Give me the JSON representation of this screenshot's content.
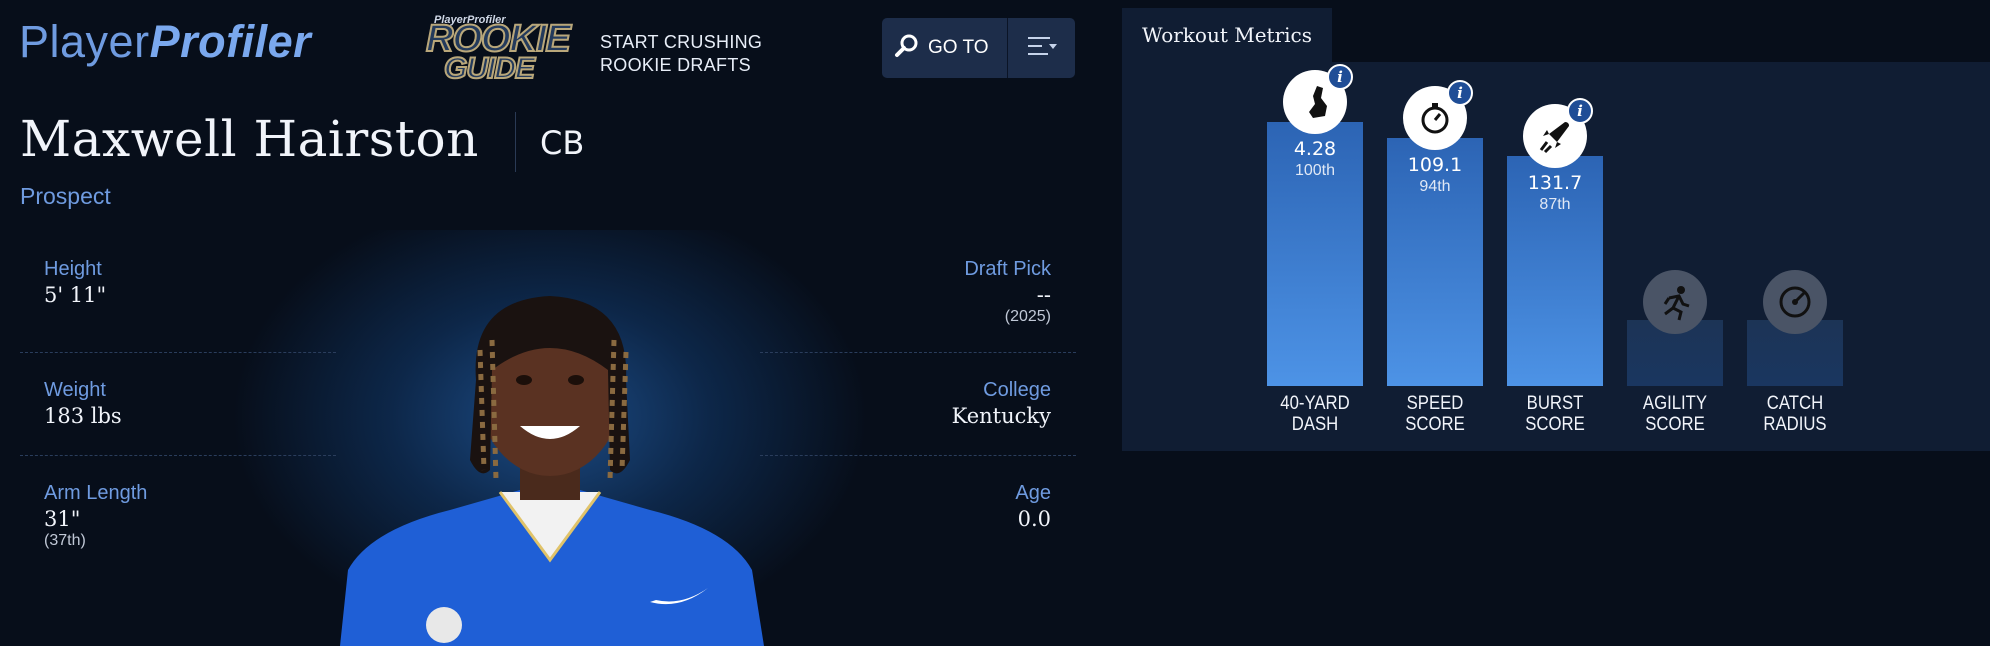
{
  "header": {
    "logo_part1": "Player",
    "logo_part2": "Profiler",
    "badge_small": "PlayerProfiler",
    "badge_line1": "ROOKIE",
    "badge_line2": "GUIDE",
    "promo_line1": "START CRUSHING",
    "promo_line2": "ROOKIE DRAFTS",
    "goto_label": "GO TO"
  },
  "player": {
    "name": "Maxwell Hairston",
    "position": "CB",
    "status": "Prospect"
  },
  "stats": {
    "height": {
      "label": "Height",
      "value": "5' 11\""
    },
    "weight": {
      "label": "Weight",
      "value": "183 lbs"
    },
    "arm_length": {
      "label": "Arm Length",
      "value": "31\"",
      "percentile": "(37th)"
    },
    "draft_pick": {
      "label": "Draft Pick",
      "value": "--",
      "year": "(2025)"
    },
    "college": {
      "label": "College",
      "value": "Kentucky"
    },
    "age": {
      "label": "Age",
      "value": "0.0"
    }
  },
  "workout": {
    "title": "Workout Metrics",
    "metrics": [
      {
        "label1": "40-YARD",
        "label2": "DASH",
        "value": "4.28",
        "percentile": "100th",
        "percentile_num": 100,
        "icon": "shoe-icon",
        "has_data": true
      },
      {
        "label1": "SPEED",
        "label2": "SCORE",
        "value": "109.1",
        "percentile": "94th",
        "percentile_num": 94,
        "icon": "stopwatch-icon",
        "has_data": true
      },
      {
        "label1": "BURST",
        "label2": "SCORE",
        "value": "131.7",
        "percentile": "87th",
        "percentile_num": 87,
        "icon": "rocket-icon",
        "has_data": true
      },
      {
        "label1": "AGILITY",
        "label2": "SCORE",
        "value": "",
        "percentile": "",
        "icon": "runner-icon",
        "has_data": false
      },
      {
        "label1": "CATCH",
        "label2": "RADIUS",
        "value": "",
        "percentile": "",
        "icon": "target-icon",
        "has_data": false
      }
    ]
  },
  "colors": {
    "accent": "#6f9be0",
    "background": "#070e1a",
    "panel": "#101d33",
    "bar": "#4d93e6"
  }
}
